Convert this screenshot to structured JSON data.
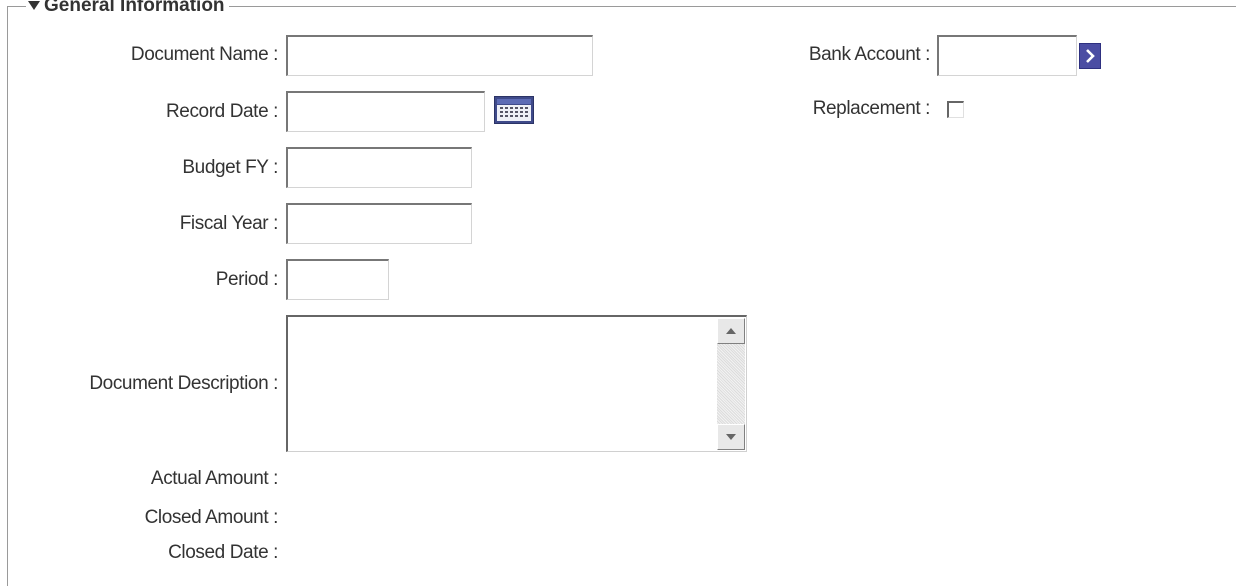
{
  "section": {
    "title": "General Information"
  },
  "icons": {
    "collapse": "triangle-down-icon",
    "calendar": "calendar-icon",
    "go": "chevron-right-icon",
    "scroll_up": "arrow-up-icon",
    "scroll_down": "arrow-down-icon"
  },
  "colors": {
    "go_button": "#4b4da3",
    "text": "#333333",
    "border": "#9a9a9a"
  },
  "fields": {
    "document_name": {
      "label": "Document Name :",
      "value": ""
    },
    "record_date": {
      "label": "Record Date :",
      "value": ""
    },
    "budget_fy": {
      "label": "Budget FY :",
      "value": ""
    },
    "fiscal_year": {
      "label": "Fiscal Year :",
      "value": ""
    },
    "period": {
      "label": "Period :",
      "value": ""
    },
    "document_description": {
      "label": "Document Description :",
      "value": ""
    },
    "actual_amount": {
      "label": "Actual Amount :",
      "value": ""
    },
    "closed_amount": {
      "label": "Closed Amount :",
      "value": ""
    },
    "closed_date": {
      "label": "Closed Date :",
      "value": ""
    },
    "bank_account": {
      "label": "Bank Account :",
      "value": ""
    },
    "replacement": {
      "label": "Replacement :",
      "checked": false
    }
  }
}
